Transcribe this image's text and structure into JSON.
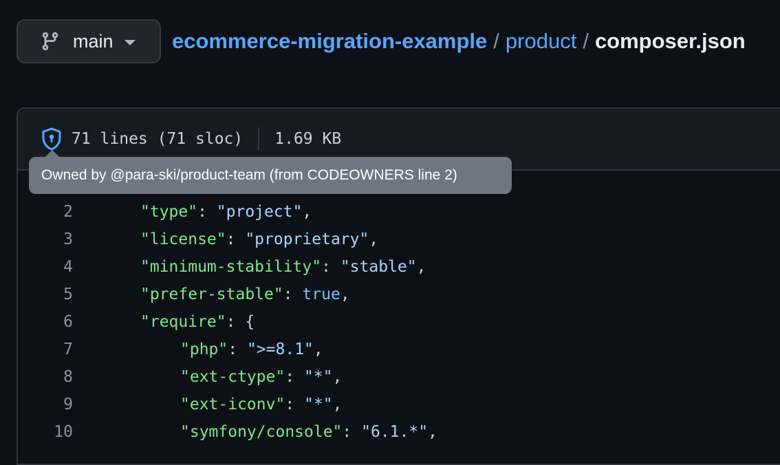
{
  "branch": {
    "name": "main"
  },
  "breadcrumb": {
    "repo": "ecommerce-migration-example",
    "sep1": "/",
    "folder": "product",
    "sep2": "/",
    "file": "composer.json"
  },
  "file_info": {
    "lines": "71 lines (71 sloc)",
    "size": "1.69 KB"
  },
  "tooltip": {
    "text": "Owned by @para-ski/product-team (from CODEOWNERS line 2)"
  },
  "code_lines": [
    {
      "num": "2",
      "key": "\"type\"",
      "colon": ": ",
      "value": "\"project\"",
      "tail": ","
    },
    {
      "num": "3",
      "key": "\"license\"",
      "colon": ": ",
      "value": "\"proprietary\"",
      "tail": ","
    },
    {
      "num": "4",
      "key": "\"minimum-stability\"",
      "colon": ": ",
      "value": "\"stable\"",
      "tail": ","
    },
    {
      "num": "5",
      "key": "\"prefer-stable\"",
      "colon": ": ",
      "value": "true",
      "tail": ","
    },
    {
      "num": "6",
      "key": "\"require\"",
      "colon": ": ",
      "value": "",
      "tail": "{"
    },
    {
      "num": "7",
      "key": "\"php\"",
      "colon": ": ",
      "value": "\">=8.1\"",
      "tail": ","
    },
    {
      "num": "8",
      "key": "\"ext-ctype\"",
      "colon": ": ",
      "value": "\"*\"",
      "tail": ","
    },
    {
      "num": "9",
      "key": "\"ext-iconv\"",
      "colon": ": ",
      "value": "\"*\"",
      "tail": ","
    },
    {
      "num": "10",
      "key": "\"symfony/console\"",
      "colon": ": ",
      "value": "\"6.1.*\"",
      "tail": ","
    }
  ],
  "colors": {
    "link": "#58a6ff",
    "json_key": "#7ee787",
    "json_string": "#a5d6ff",
    "json_bool": "#79c0ff",
    "background": "#0d1117"
  }
}
